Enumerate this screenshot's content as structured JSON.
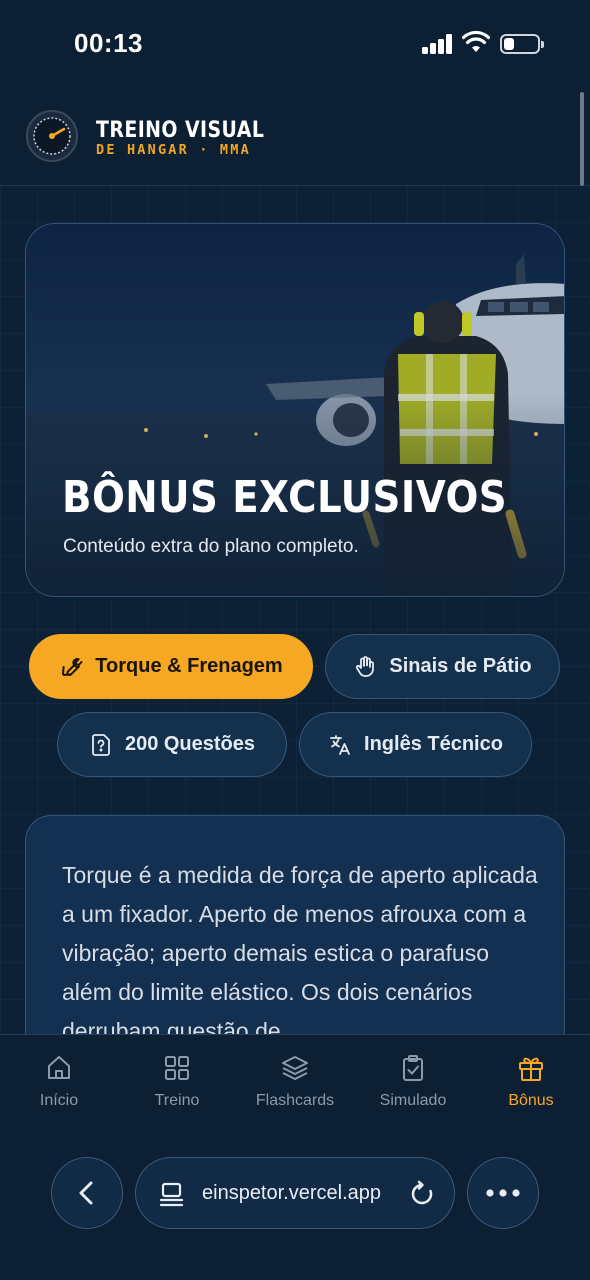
{
  "status_bar": {
    "time": "00:13"
  },
  "header": {
    "brand_title": "TREINO VISUAL",
    "brand_subtitle": "DE HANGAR · MMA",
    "logo_icon": "gauge-logo-icon"
  },
  "hero": {
    "title": "BÔNUS EXCLUSIVOS",
    "subtitle": "Conteúdo extra do plano completo."
  },
  "tabs": [
    {
      "label": "Torque & Frenagem",
      "icon": "wrench-icon",
      "active": true
    },
    {
      "label": "Sinais de Pátio",
      "icon": "hand-icon",
      "active": false
    },
    {
      "label": "200 Questões",
      "icon": "question-file-icon",
      "active": false
    },
    {
      "label": "Inglês Técnico",
      "icon": "translate-icon",
      "active": false
    }
  ],
  "content": {
    "text": "Torque é a medida de força de aperto aplicada a um fixador. Aperto de menos afrouxa com a vibração; aperto demais estica o parafuso além do limite elástico. Os dois cenários derrubam questão de"
  },
  "bottom_nav": [
    {
      "label": "Início",
      "icon": "home-icon",
      "active": false
    },
    {
      "label": "Treino",
      "icon": "grid-icon",
      "active": false
    },
    {
      "label": "Flashcards",
      "icon": "layers-icon",
      "active": false
    },
    {
      "label": "Simulado",
      "icon": "clipboard-check-icon",
      "active": false
    },
    {
      "label": "Bônus",
      "icon": "gift-icon",
      "active": true
    }
  ],
  "browser": {
    "url": "einspetor.vercel.app"
  },
  "colors": {
    "accent": "#f6a823",
    "background": "#0c2036",
    "card": "#143050",
    "muted_text": "#8d9aab"
  }
}
